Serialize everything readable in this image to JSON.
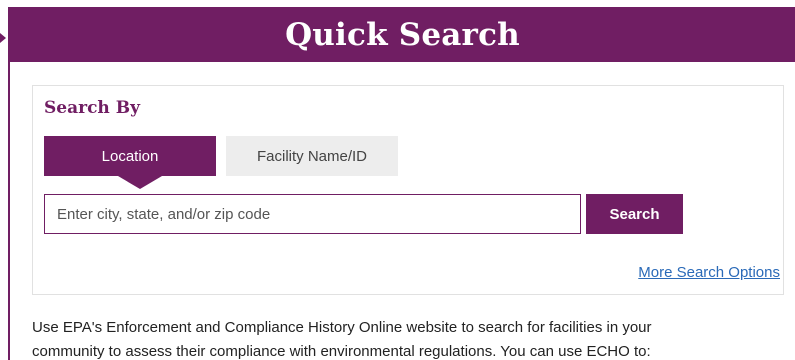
{
  "header": {
    "title": "Quick Search"
  },
  "search": {
    "heading": "Search By",
    "tabs": [
      {
        "label": "Location",
        "active": true
      },
      {
        "label": "Facility Name/ID",
        "active": false
      }
    ],
    "input_value": "",
    "input_placeholder": "Enter city, state, and/or zip code",
    "button_label": "Search",
    "more_options_label": "More Search Options"
  },
  "intro": {
    "line1": "Use EPA's Enforcement and Compliance History Online website to search for facilities in your",
    "line2": "community to assess their compliance with environmental regulations. You can use ECHO to:"
  },
  "colors": {
    "brand": "#701e63",
    "link": "#2a6ab8",
    "tab_inactive": "#ededed"
  }
}
